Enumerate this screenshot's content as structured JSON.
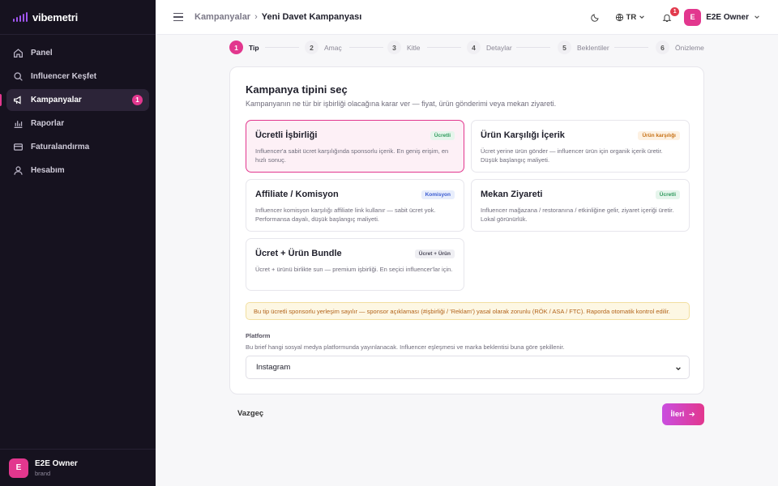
{
  "brand": {
    "name": "vibemetri",
    "accent": "#a056f0"
  },
  "sidebar": {
    "items": [
      {
        "label": "Panel",
        "icon": "home-icon"
      },
      {
        "label": "Influencer Keşfet",
        "icon": "search-icon"
      },
      {
        "label": "Kampanyalar",
        "icon": "megaphone-icon",
        "badge": "1",
        "active": true
      },
      {
        "label": "Raporlar",
        "icon": "bar-chart-icon"
      },
      {
        "label": "Faturalandırma",
        "icon": "credit-card-icon"
      },
      {
        "label": "Hesabım",
        "icon": "user-icon"
      }
    ],
    "user": {
      "initial": "E",
      "name": "E2E Owner",
      "role": "brand"
    }
  },
  "header": {
    "breadcrumb_parent": "Kampanyalar",
    "breadcrumb_sep": "›",
    "breadcrumb_current": "Yeni Davet Kampanyası",
    "language": "TR",
    "notification_count": "1",
    "user_initial": "E",
    "user_name": "E2E Owner"
  },
  "stepper": [
    {
      "num": "1",
      "label": "Tip",
      "active": true
    },
    {
      "num": "2",
      "label": "Amaç"
    },
    {
      "num": "3",
      "label": "Kitle"
    },
    {
      "num": "4",
      "label": "Detaylar"
    },
    {
      "num": "5",
      "label": "Beklentiler"
    },
    {
      "num": "6",
      "label": "Önizleme"
    }
  ],
  "card": {
    "title": "Kampanya tipini seç",
    "subtitle": "Kampanyanın ne tür bir işbirliği olacağına karar ver — fiyat, ürün gönderimi veya mekan ziyareti.",
    "options": [
      {
        "title": "Ücretli İşbirliği",
        "tag": "Ücretli",
        "desc": "Influencer'a sabit ücret karşılığında sponsorlu içerik. En geniş erişim, en hızlı sonuç.",
        "selected": true
      },
      {
        "title": "Ürün Karşılığı İçerik",
        "tag": "Ürün karşılığı",
        "desc": "Ücret yerine ürün gönder — influencer ürün için organik içerik üretir. Düşük başlangıç maliyeti."
      },
      {
        "title": "Affiliate / Komisyon",
        "tag": "Komisyon",
        "desc": "Influencer komisyon karşılığı affiliate link kullanır — sabit ücret yok. Performansa dayalı, düşük başlangıç maliyeti."
      },
      {
        "title": "Mekan Ziyareti",
        "tag": "Ücretli",
        "desc": "Influencer mağazana / restoranına / etkinliğine gelir, ziyaret içeriği üretir. Lokal görünürlük."
      },
      {
        "title": "Ücret + Ürün Bundle",
        "tag": "Ücret + Ürün",
        "desc": "Ücret + ürünü birlikte sun — premium işbirliği. En seçici influencer'lar için."
      }
    ],
    "notice": "Bu tip ücretli sponsorlu yerleşim sayılır — sponsor açıklaması (#işbirliği / 'Reklam') yasal olarak zorunlu (RÖK / ASA / FTC). Raporda otomatik kontrol edilir.",
    "platform_label": "Platform",
    "platform_help": "Bu brief hangi sosyal medya platformunda yayınlanacak. Influencer eşleşmesi ve marka beklentisi buna göre şekillenir.",
    "platform_value": "Instagram"
  },
  "actions": {
    "cancel": "Vazgeç",
    "next": "İleri"
  },
  "colors": {
    "primary": "#e2378e",
    "sidebar_bg": "#16121f"
  }
}
